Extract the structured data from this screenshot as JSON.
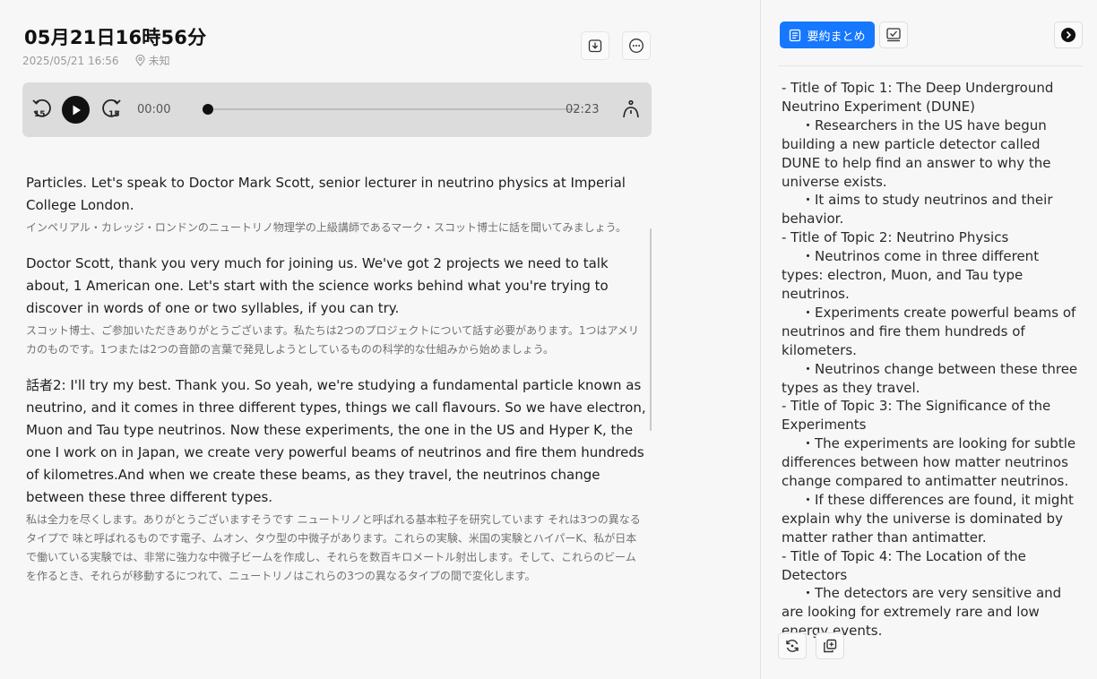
{
  "header": {
    "title": "05月21日16時56分",
    "datetime": "2025/05/21 16:56",
    "location": "未知"
  },
  "player": {
    "current_time": "00:00",
    "total_time": "02:23",
    "progress": 0,
    "rewind_seconds": "15",
    "forward_seconds": "15"
  },
  "transcript": [
    {
      "en": "Particles. Let's speak to Doctor Mark Scott, senior lecturer in neutrino physics at Imperial College London.",
      "jp": "インペリアル・カレッジ・ロンドンのニュートリノ物理学の上級講師であるマーク・スコット博士に話を聞いてみましょう。"
    },
    {
      "en": "Doctor Scott, thank you very much for joining us. We've got 2 projects we need to talk about, 1 American one. Let's start with the science works behind what you're trying to discover in words of one or two syllables, if you can try.",
      "jp": "スコット博士、ご参加いただきありがとうございます。私たちは2つのプロジェクトについて話す必要があります。1つはアメリカのものです。1つまたは2つの音節の言葉で発見しようとしているものの科学的な仕組みから始めましょう。"
    },
    {
      "en": "話者2:  I'll try my best. Thank you. So yeah, we're studying a fundamental particle known as neutrino, and it comes in three different types, things we call flavours. So we have electron, Muon and Tau type neutrinos. Now these experiments, the one in the US and Hyper K, the one I work on in Japan, we create very powerful beams of neutrinos and fire them hundreds of kilometres.And when we create these beams, as they travel, the neutrinos change between these three different types.",
      "jp": "私は全力を尽くします。ありがとうございますそうです ニュートリノと呼ばれる基本粒子を研究しています それは3つの異なるタイプで 味と呼ばれるものです電子、ムオン、タウ型の中微子があります。これらの実験、米国の実験とハイパーK、私が日本で働いている実験では、非常に強力な中微子ビームを作成し、それらを数百キロメートル射出します。そして、これらのビームを作るとき、それらが移動するにつれて、ニュートリノはこれらの3つの異なるタイプの間で変化します。"
    }
  ],
  "panel": {
    "summary_tab_label": "要約まとめ",
    "accent_color": "#1677ff",
    "summary_lines": [
      {
        "text": "- Title of Topic 1: The Deep Underground Neutrino Experiment (DUNE)",
        "indent": false
      },
      {
        "text": "・Researchers in the US have begun building a new particle detector called DUNE to help find an answer to why the universe exists.",
        "indent": true
      },
      {
        "text": "・It aims to study neutrinos and their behavior.",
        "indent": true
      },
      {
        "text": "- Title of Topic 2: Neutrino Physics",
        "indent": false
      },
      {
        "text": "・Neutrinos come in three different types: electron, Muon, and Tau type neutrinos.",
        "indent": true
      },
      {
        "text": "・Experiments create powerful beams of neutrinos and fire them hundreds of kilometers.",
        "indent": true
      },
      {
        "text": "・Neutrinos change between these three types as they travel.",
        "indent": true
      },
      {
        "text": "- Title of Topic 3: The Significance of the Experiments",
        "indent": false
      },
      {
        "text": "・The experiments are looking for subtle differences between how matter neutrinos change compared to antimatter neutrinos.",
        "indent": true
      },
      {
        "text": "・If these differences are found, it might explain why the universe is dominated by matter rather than antimatter.",
        "indent": true
      },
      {
        "text": "- Title of Topic 4: The Location of the Detectors",
        "indent": false
      },
      {
        "text": "・The detectors are very sensitive and are looking for extremely rare and low energy events.",
        "indent": true
      }
    ]
  },
  "icons": {
    "export": "export-icon",
    "more": "more-icon",
    "rewind": "rewind-15-icon",
    "play": "play-icon",
    "forward": "forward-15-icon",
    "speaker": "speaker-icon",
    "summary": "document-icon",
    "checklist": "checklist-icon",
    "arrow": "arrow-right-icon",
    "regenerate": "regenerate-icon",
    "copy": "copy-icon",
    "location": "location-pin-icon"
  }
}
